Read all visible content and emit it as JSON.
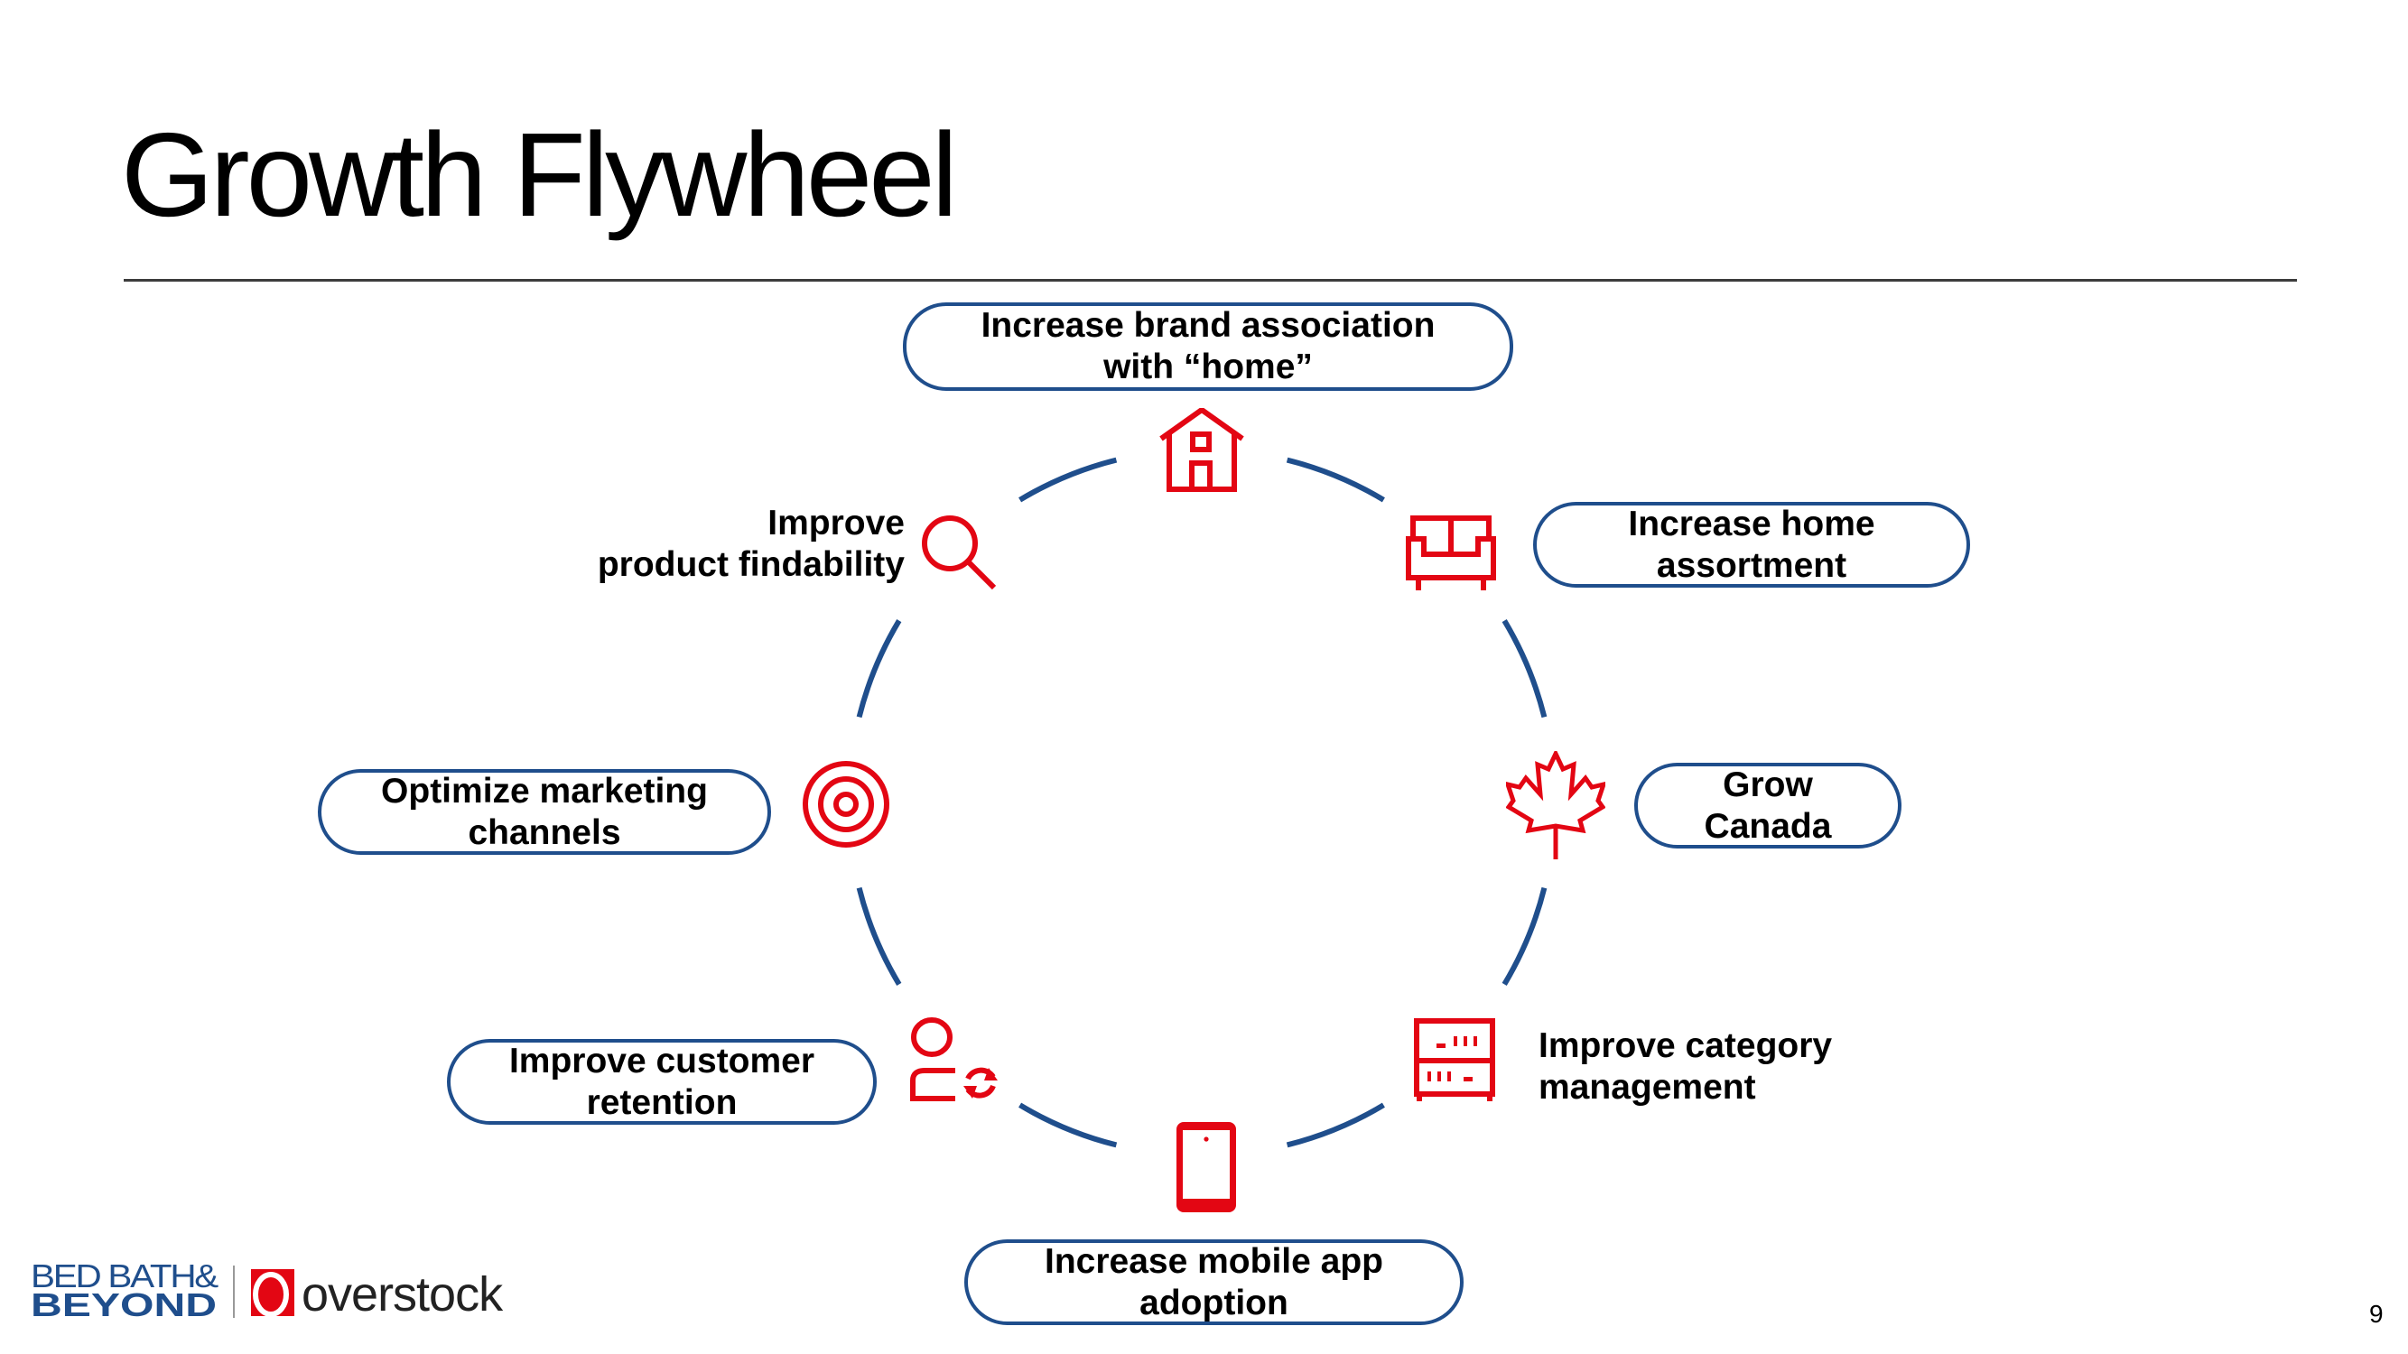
{
  "slide": {
    "title": "Growth Flywheel",
    "page_number": "9"
  },
  "colors": {
    "accent_red": "#e30613",
    "ring_blue": "#1f4e8c",
    "brand_blue": "#1f4e8c"
  },
  "flywheel": {
    "items": [
      {
        "id": "brand-home",
        "label": "Increase brand association\nwith “home”",
        "icon": "house-icon",
        "boxed": true
      },
      {
        "id": "home-assortment",
        "label": "Increase home\nassortment",
        "icon": "sofa-icon",
        "boxed": true
      },
      {
        "id": "grow-canada",
        "label": "Grow\nCanada",
        "icon": "maple-leaf-icon",
        "boxed": true
      },
      {
        "id": "category-management",
        "label": "Improve category\nmanagement",
        "icon": "cabinet-icon",
        "boxed": false
      },
      {
        "id": "mobile-app",
        "label": "Increase mobile app\nadoption",
        "icon": "mobile-phone-icon",
        "boxed": true
      },
      {
        "id": "customer-retention",
        "label": "Improve customer\nretention",
        "icon": "customer-refresh-icon",
        "boxed": true
      },
      {
        "id": "marketing-channels",
        "label": "Optimize marketing\nchannels",
        "icon": "target-icon",
        "boxed": true
      },
      {
        "id": "product-findability",
        "label": "Improve\nproduct findability",
        "icon": "magnifier-icon",
        "boxed": false
      }
    ]
  },
  "footer": {
    "logo_bbb_line1": "BED BATH&",
    "logo_bbb_line2": "BEYOND",
    "logo_overstock_mark": "O",
    "logo_overstock_text": "overstock"
  }
}
